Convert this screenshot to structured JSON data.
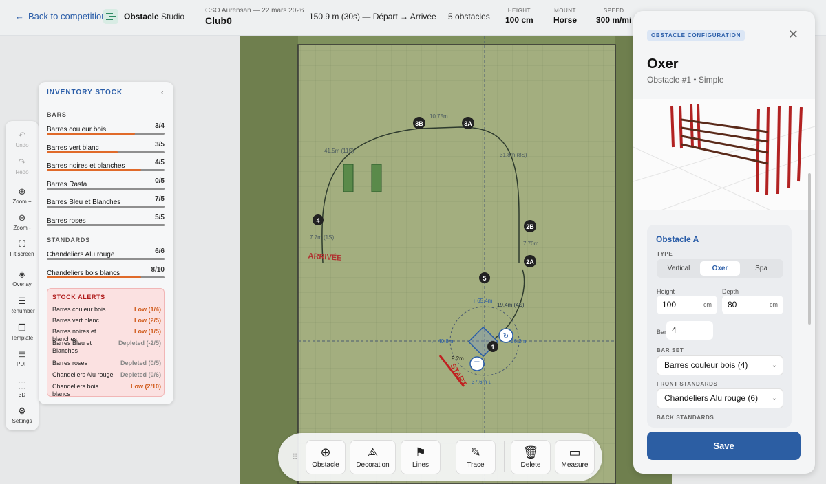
{
  "header": {
    "back_label": "Back to competition",
    "logo_bold": "Obstacle",
    "logo_light": "Studio",
    "competition": "CSO Aurensan — 22 mars 2026",
    "course_name": "Club0",
    "distance": "150.9 m (30s) — Départ → Arrivée",
    "obstacle_count": "5 obstacles",
    "stats": [
      {
        "label": "HEIGHT",
        "value": "100 cm"
      },
      {
        "label": "MOUNT",
        "value": "Horse"
      },
      {
        "label": "SPEED",
        "value": "300 m/mi"
      }
    ]
  },
  "map": {
    "markers": [
      "3B",
      "3A",
      "4",
      "2B",
      "2A",
      "5",
      "1"
    ],
    "labels": [
      "10.75m",
      "41.5m (11S)",
      "31.8m (8S)",
      "7.7m (1S)",
      "7.70m",
      "↑ 65.4m",
      "19.4m (4S)",
      "← 40.8m",
      "36.2m →",
      "9.2m",
      "37.6m ↓"
    ],
    "finish_text": "ARRIVÉE",
    "start_text": "START"
  },
  "tools": [
    {
      "icon": "↶",
      "label": "Undo",
      "disabled": true
    },
    {
      "icon": "↷",
      "label": "Redo",
      "disabled": true
    },
    {
      "icon": "⊕",
      "label": "Zoom +",
      "disabled": false
    },
    {
      "icon": "⊖",
      "label": "Zoom -",
      "disabled": false
    },
    {
      "icon": "⛶",
      "label": "Fit screen",
      "disabled": false
    },
    {
      "icon": "◈",
      "label": "Overlay",
      "disabled": false
    },
    {
      "icon": "☰",
      "label": "Renumber",
      "disabled": false
    },
    {
      "icon": "❐",
      "label": "Template",
      "disabled": false
    },
    {
      "icon": "▤",
      "label": "PDF",
      "disabled": false
    },
    {
      "icon": "⬚",
      "label": "3D",
      "disabled": false
    },
    {
      "icon": "⚙",
      "label": "Settings",
      "disabled": false
    }
  ],
  "inventory": {
    "title": "INVENTORY STOCK",
    "bars_heading": "BARS",
    "bars": [
      {
        "name": "Barres couleur bois",
        "count": "3/4",
        "fill": 0.75,
        "color": "#e06a2a"
      },
      {
        "name": "Barres vert blanc",
        "count": "3/5",
        "fill": 0.6,
        "color": "#e06a2a"
      },
      {
        "name": "Barres noires et blanches",
        "count": "4/5",
        "fill": 0.8,
        "color": "#e06a2a"
      },
      {
        "name": "Barres Rasta",
        "count": "0/5",
        "fill": 1.0,
        "color": "#8f8f8f"
      },
      {
        "name": "Barres Bleu et Blanches",
        "count": "7/5",
        "fill": 1.0,
        "color": "#8f8f8f"
      },
      {
        "name": "Barres roses",
        "count": "5/5",
        "fill": 1.0,
        "color": "#8f8f8f"
      }
    ],
    "standards_heading": "STANDARDS",
    "standards": [
      {
        "name": "Chandeliers Alu rouge",
        "count": "6/6",
        "fill": 1.0,
        "color": "#8f8f8f"
      },
      {
        "name": "Chandeliers bois blancs",
        "count": "8/10",
        "fill": 0.8,
        "color": "#e06a2a"
      }
    ],
    "alerts_heading": "STOCK ALERTS",
    "alerts": [
      {
        "name": "Barres couleur bois",
        "status": "Low (1/4)",
        "kind": "low"
      },
      {
        "name": "Barres vert blanc",
        "status": "Low (2/5)",
        "kind": "low"
      },
      {
        "name": "Barres noires et blanches",
        "status": "Low (1/5)",
        "kind": "low"
      },
      {
        "name": "Barres Bleu et Blanches",
        "status": "Depleted (-2/5)",
        "kind": "dep"
      },
      {
        "name": "Barres roses",
        "status": "Depleted (0/5)",
        "kind": "dep"
      },
      {
        "name": "Chandeliers Alu rouge",
        "status": "Depleted (0/6)",
        "kind": "dep"
      },
      {
        "name": "Chandeliers bois blancs",
        "status": "Low (2/10)",
        "kind": "low"
      }
    ]
  },
  "bottom_tools": [
    {
      "icon": "⊕",
      "label": "Obstacle"
    },
    {
      "icon": "⟁",
      "label": "Decoration"
    },
    {
      "icon": "⚑",
      "label": "Lines"
    },
    {
      "icon": "✎",
      "label": "Trace"
    },
    {
      "icon": "🗑",
      "label": "Delete"
    },
    {
      "icon": "▭",
      "label": "Measure"
    }
  ],
  "config": {
    "badge": "OBSTACLE CONFIGURATION",
    "title": "Oxer",
    "subtitle": "Obstacle #1 • Simple",
    "section_title": "Obstacle A",
    "type_label": "TYPE",
    "types": [
      "Vertical",
      "Oxer",
      "Spa"
    ],
    "active_type": "Oxer",
    "height_label": "Height",
    "height_value": "100",
    "height_unit": "cm",
    "depth_label": "Depth",
    "depth_value": "80",
    "depth_unit": "cm",
    "bars_label": "Bars",
    "bars_value": "4",
    "barset_label": "BAR SET",
    "barset_value": "Barres couleur bois (4)",
    "front_label": "FRONT STANDARDS",
    "front_value": "Chandeliers Alu rouge (6)",
    "back_label": "BACK STANDARDS",
    "save_label": "Save"
  }
}
